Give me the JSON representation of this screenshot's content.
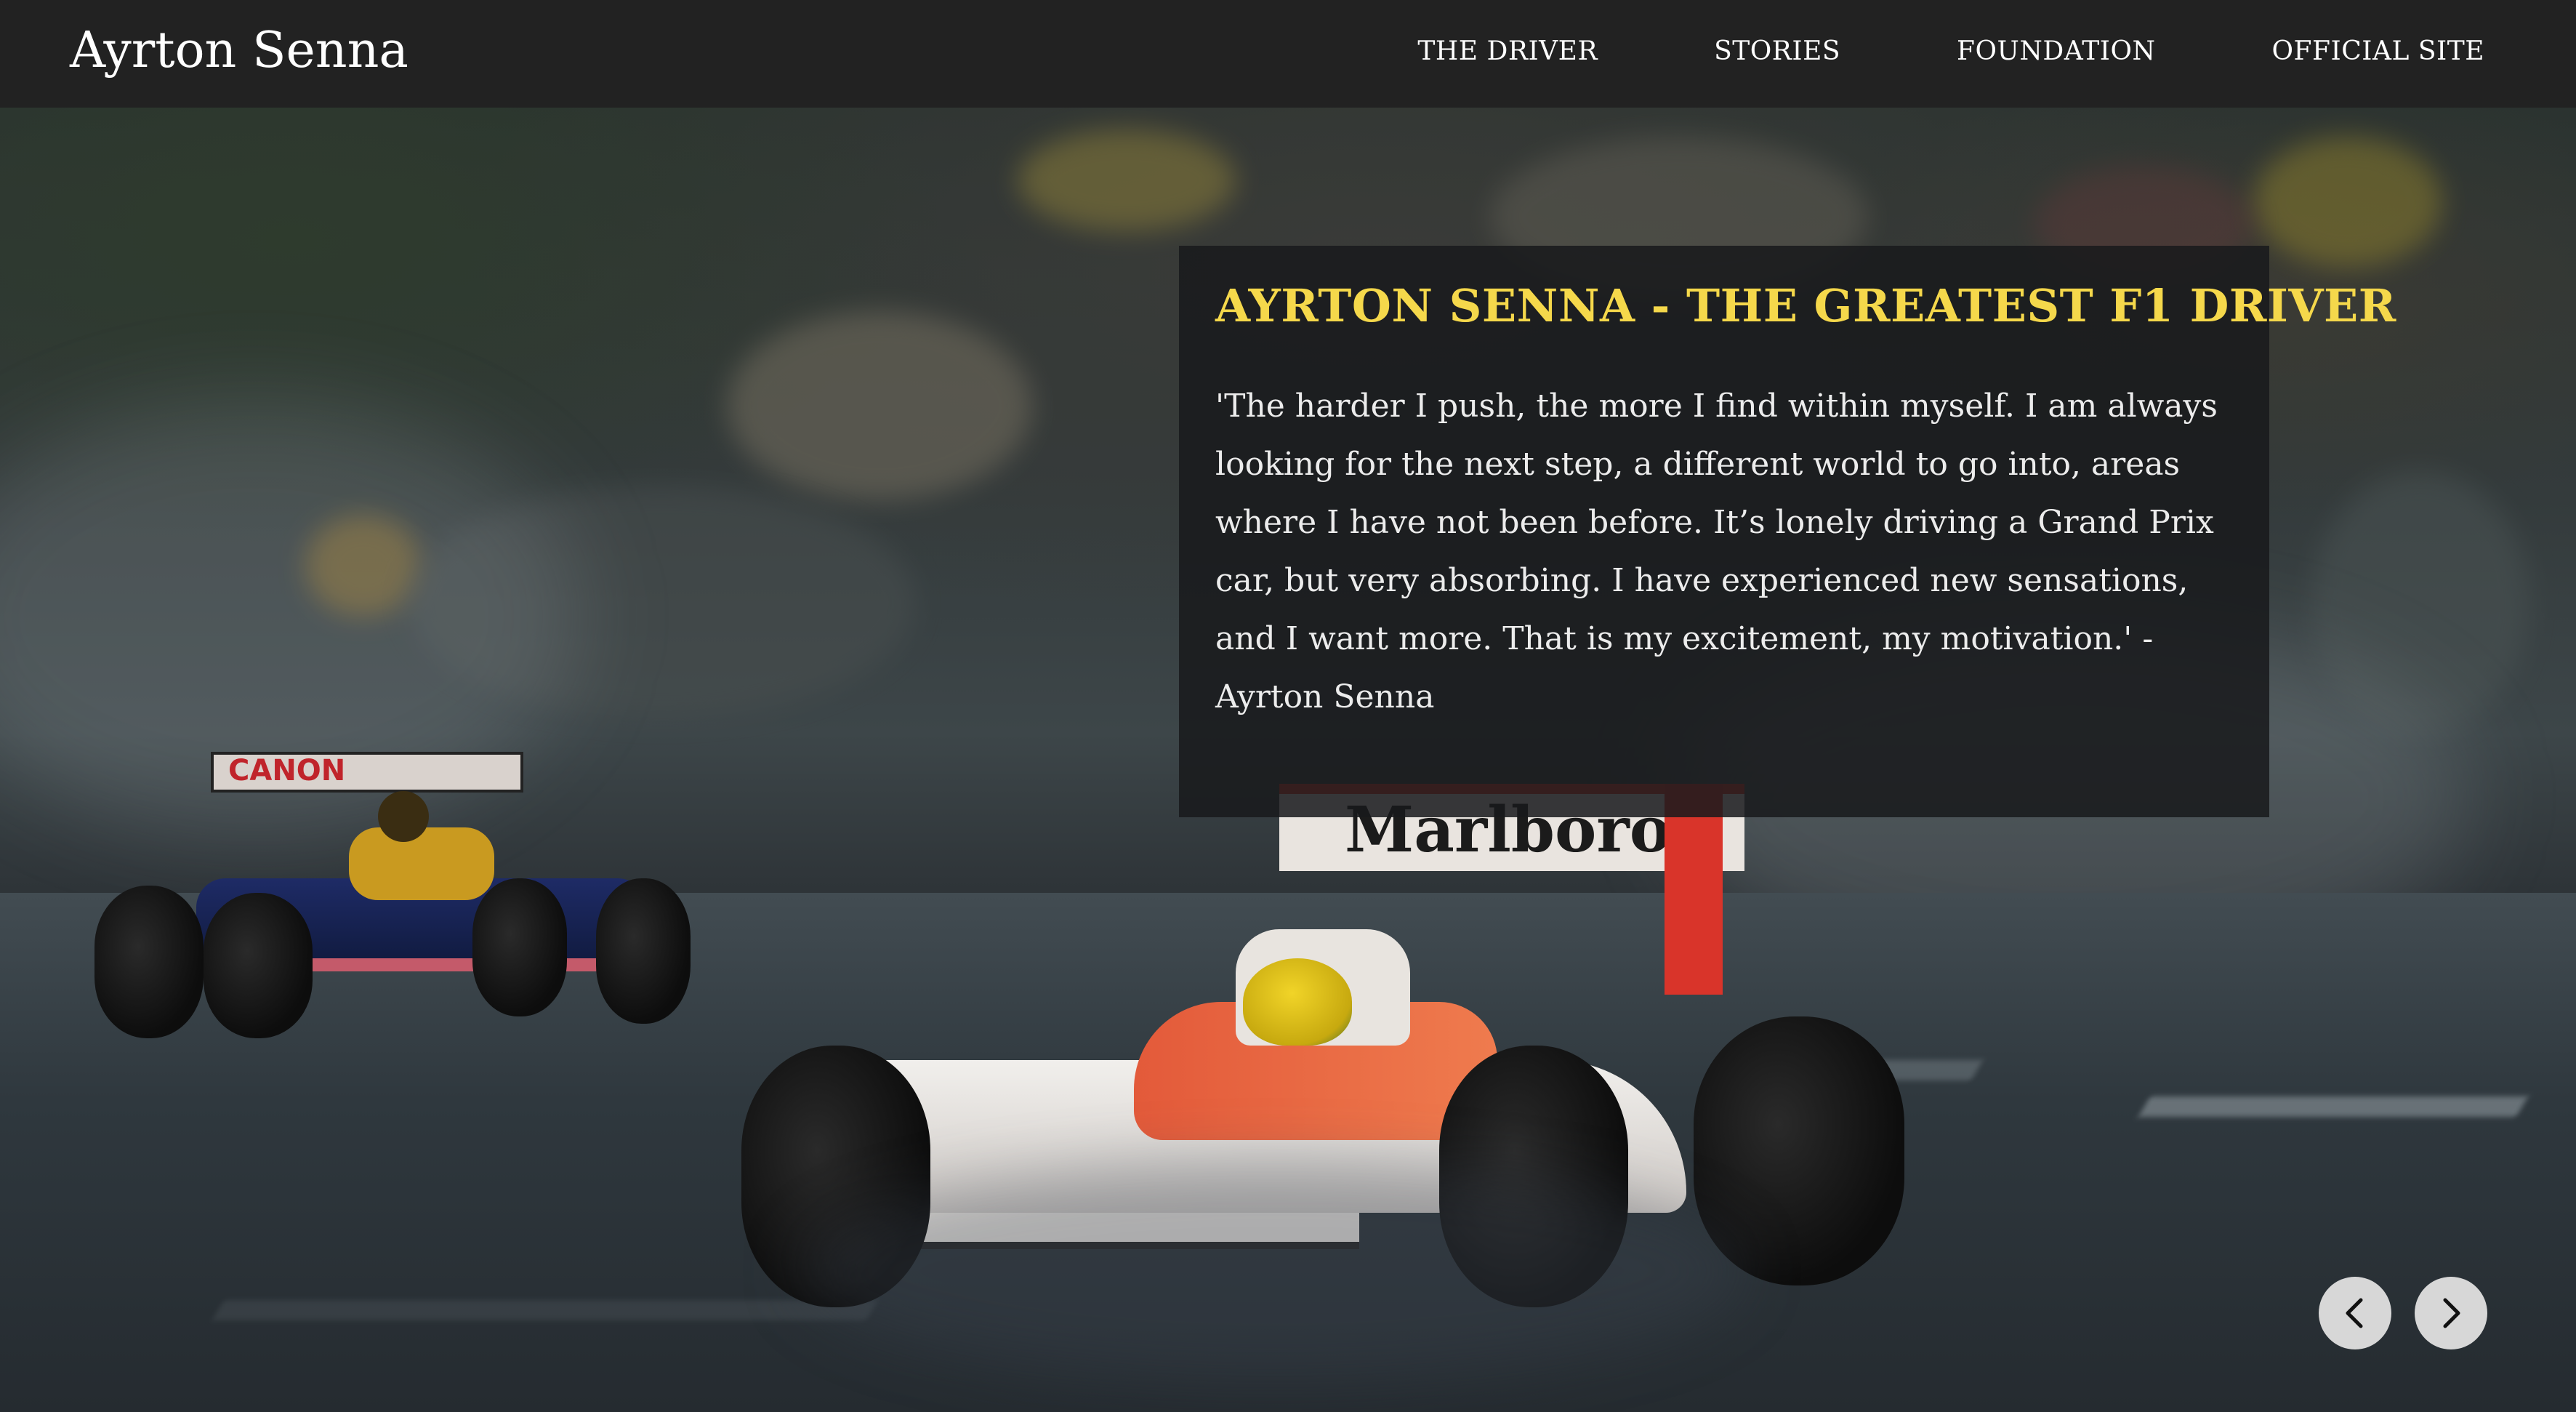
{
  "header": {
    "brand": "Ayrton Senna",
    "nav": [
      {
        "label": "THE DRIVER"
      },
      {
        "label": "STORIES"
      },
      {
        "label": "FOUNDATION"
      },
      {
        "label": "OFFICIAL SITE"
      }
    ]
  },
  "hero": {
    "heading": "AYRTON SENNA - THE GREATEST F1 DRIVER",
    "quote": "'The harder I push, the more I find within myself. I am always looking for the next step, a different world to go into, areas where I have not been before. It’s lonely driving a Grand Prix car, but very absorbing. I have experienced new sensations, and I want more. That is my excitement, my motivation.' - Ayrton Senna",
    "car_sponsor_text": "Marlboro",
    "rival_car_sponsor_text": "CANON"
  },
  "carousel": {
    "prev_icon": "chevron-left-icon",
    "next_icon": "chevron-right-icon"
  },
  "colors": {
    "navbar_bg": "#222222",
    "heading_accent": "#f5d84b",
    "quote_text": "#ececec",
    "button_bg": "#d7d7d7"
  }
}
